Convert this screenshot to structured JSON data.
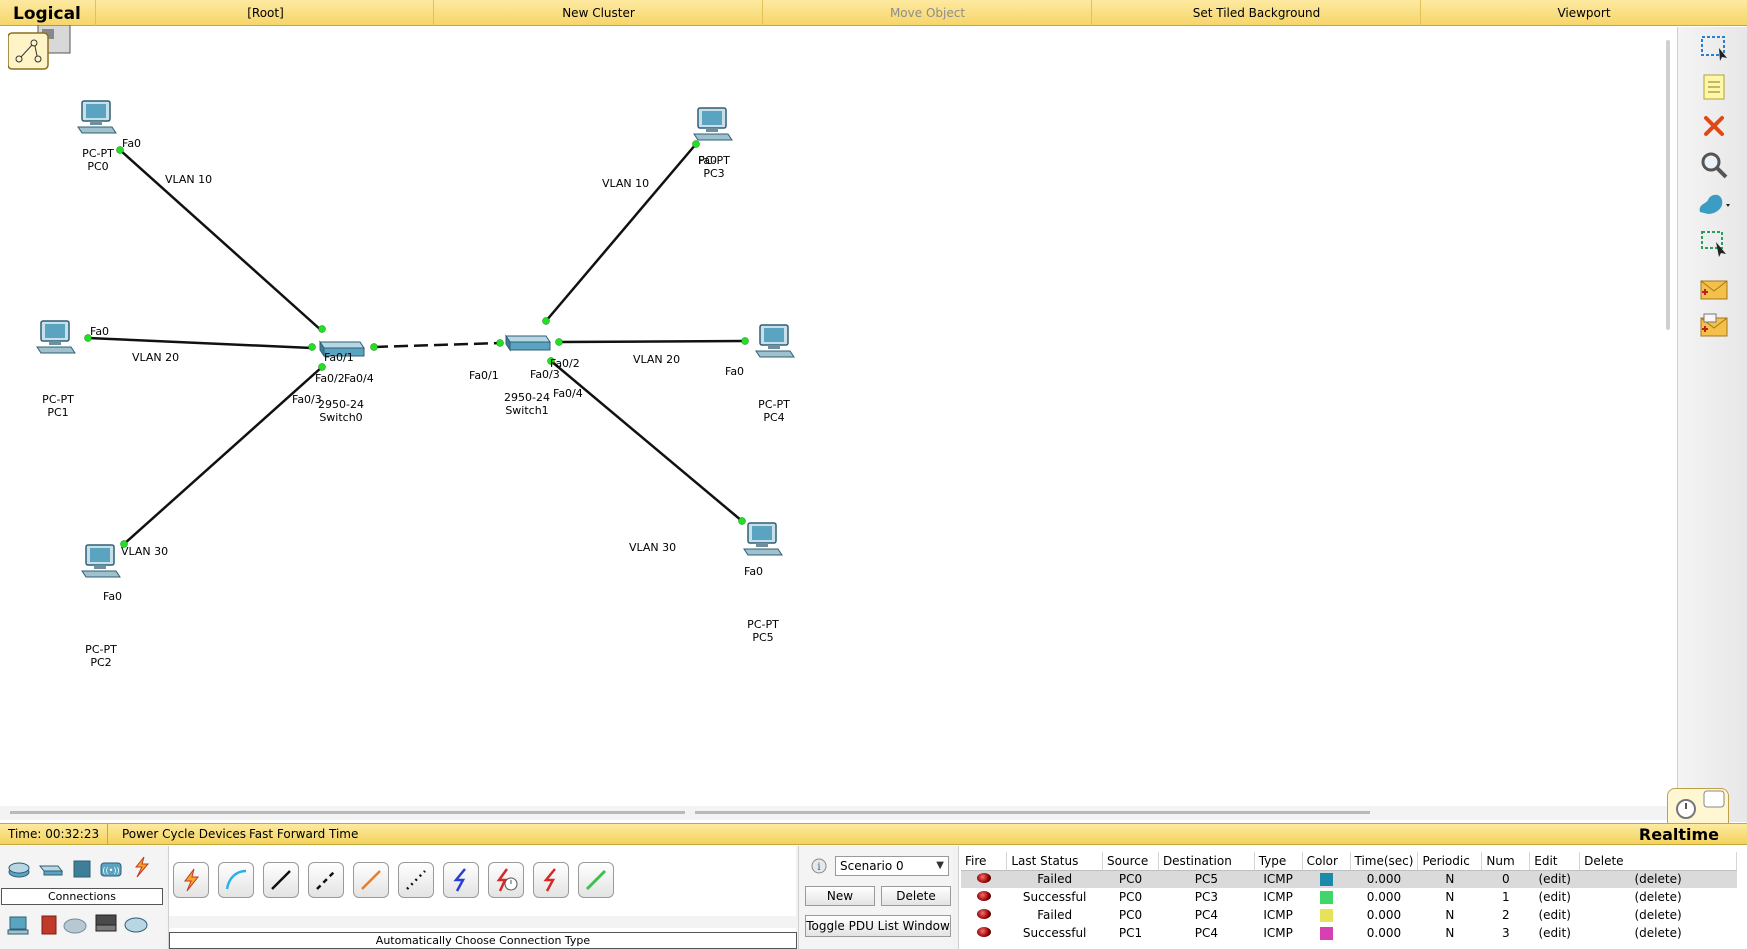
{
  "toolbar": {
    "mode_title": "Logical",
    "root": "[Root]",
    "new_cluster": "New Cluster",
    "move_object": "Move Object",
    "set_tiled_background": "Set Tiled Background",
    "viewport": "Viewport"
  },
  "devices": {
    "pc0": {
      "model": "PC-PT",
      "name": "PC0",
      "port": "Fa0"
    },
    "pc1": {
      "model": "PC-PT",
      "name": "PC1",
      "port": "Fa0"
    },
    "pc2": {
      "model": "PC-PT",
      "name": "PC2",
      "port": "Fa0"
    },
    "pc3": {
      "model": "PC-PT",
      "name": "PC3",
      "port": "Fa0"
    },
    "pc4": {
      "model": "PC-PT",
      "name": "PC4",
      "port": "Fa0"
    },
    "pc5": {
      "model": "PC-PT",
      "name": "PC5",
      "port": "Fa0"
    },
    "switch0": {
      "model": "2950-24",
      "name": "Switch0",
      "ports": [
        "Fa0/1",
        "Fa0/2",
        "Fa0/4",
        "Fa0/3"
      ]
    },
    "switch1": {
      "model": "2950-24",
      "name": "Switch1",
      "ports": [
        "Fa0/1",
        "Fa0/2",
        "Fa0/3",
        "Fa0/4"
      ]
    }
  },
  "vlan_labels": {
    "pc0_link": "VLAN 10",
    "pc1_link": "VLAN 20",
    "pc2_link": "VLAN 30",
    "pc3_link": "VLAN 10",
    "pc4_link": "VLAN 20",
    "pc5_link": "VLAN 30"
  },
  "status": {
    "time": "Time: 00:32:23",
    "power_cycle": "Power Cycle Devices",
    "fast_forward": "Fast Forward Time",
    "mode": "Realtime"
  },
  "bottom": {
    "connections_label": "Connections",
    "connection_type_desc": "Automatically Choose Connection Type",
    "scenario": "Scenario 0",
    "new_button": "New",
    "delete_button": "Delete",
    "toggle_pdu": "Toggle PDU List Window"
  },
  "pdu_table": {
    "headers": [
      "Fire",
      "Last Status",
      "Source",
      "Destination",
      "Type",
      "Color",
      "Time(sec)",
      "Periodic",
      "Num",
      "Edit",
      "Delete"
    ],
    "rows": [
      {
        "status": "Failed",
        "source": "PC0",
        "destination": "PC5",
        "type": "ICMP",
        "color": "#1f8aa8",
        "time": "0.000",
        "periodic": "N",
        "num": "0",
        "edit": "(edit)",
        "delete": "(delete)"
      },
      {
        "status": "Successful",
        "source": "PC0",
        "destination": "PC3",
        "type": "ICMP",
        "color": "#3fd66a",
        "time": "0.000",
        "periodic": "N",
        "num": "1",
        "edit": "(edit)",
        "delete": "(delete)"
      },
      {
        "status": "Failed",
        "source": "PC0",
        "destination": "PC4",
        "type": "ICMP",
        "color": "#e6e35a",
        "time": "0.000",
        "periodic": "N",
        "num": "2",
        "edit": "(edit)",
        "delete": "(delete)"
      },
      {
        "status": "Successful",
        "source": "PC1",
        "destination": "PC4",
        "type": "ICMP",
        "color": "#d640b0",
        "time": "0.000",
        "periodic": "N",
        "num": "3",
        "edit": "(edit)",
        "delete": "(delete)"
      }
    ]
  },
  "icons": {
    "right_toolbar": [
      "select-icon",
      "note-icon",
      "delete-icon",
      "inspect-icon",
      "draw-shape-icon",
      "resize-icon",
      "add-simple-pdu-icon",
      "add-complex-pdu-icon"
    ],
    "connections": [
      "auto-connection-icon",
      "console-cable-icon",
      "straight-through-icon",
      "crossover-icon",
      "fiber-icon",
      "phone-cable-icon",
      "coaxial-icon",
      "serial-dce-icon",
      "serial-dte-icon",
      "usb-cable-icon"
    ]
  }
}
